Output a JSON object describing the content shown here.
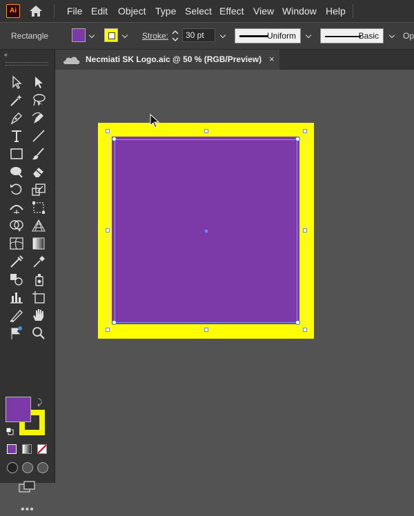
{
  "app": {
    "logo_text": "Ai"
  },
  "menu": {
    "items": [
      "File",
      "Edit",
      "Object",
      "Type",
      "Select",
      "Effect",
      "View",
      "Window",
      "Help"
    ]
  },
  "control_bar": {
    "object_type": "Rectangle",
    "fill_color": "#7b3aa8",
    "stroke_color": "#ffff00",
    "stroke_label": "Stroke:",
    "stroke_weight": "30 pt",
    "variable_width_profile": "Uniform",
    "brush_definition": "Basic",
    "opacity_label": "Op"
  },
  "document_tab": {
    "title": "Necmiati SK Logo.aic @ 50 % (RGB/Preview)",
    "close_symbol": "×"
  },
  "toolbar": {
    "collapse_symbol": "«",
    "fill_color": "#7b3aa8",
    "stroke_color": "#ffff00",
    "more_symbol": "•••"
  },
  "canvas": {
    "artwork": {
      "fill_color": "#7b3aa8",
      "stroke_color": "#ffff00",
      "stroke_weight_pt": 30
    }
  }
}
